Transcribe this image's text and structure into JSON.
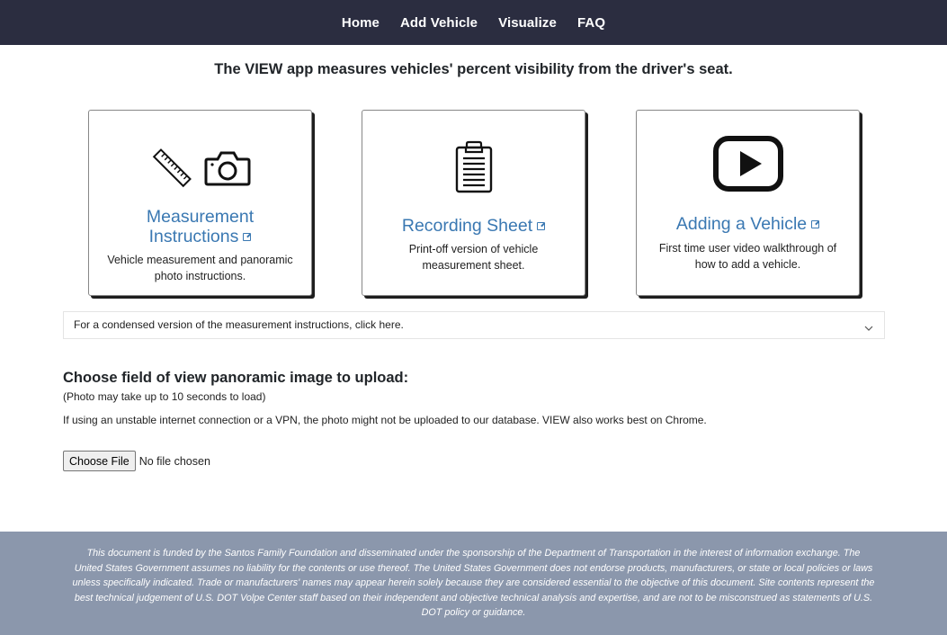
{
  "nav": {
    "items": [
      {
        "label": "Home"
      },
      {
        "label": "Add Vehicle"
      },
      {
        "label": "Visualize"
      },
      {
        "label": "FAQ"
      }
    ]
  },
  "headline": "The VIEW app measures vehicles' percent visibility from the driver's seat.",
  "cards": [
    {
      "title": "Measurement Instructions",
      "description": "Vehicle measurement and panoramic photo instructions.",
      "icons": [
        "ruler-icon",
        "camera-icon",
        "external-link-icon"
      ]
    },
    {
      "title": "Recording Sheet",
      "description": "Print-off version of vehicle measurement sheet.",
      "icons": [
        "clipboard-icon",
        "external-link-icon"
      ]
    },
    {
      "title": "Adding a Vehicle",
      "description": "First time user video walkthrough of how to add a vehicle.",
      "icons": [
        "video-play-icon",
        "external-link-icon"
      ]
    }
  ],
  "accordion": {
    "label": "For a condensed version of the measurement instructions, click here.",
    "icon": "chevron-down-icon"
  },
  "upload": {
    "title": "Choose field of view panoramic image to upload:",
    "subtitle": "(Photo may take up to 10 seconds to load)",
    "note": "If using an unstable internet connection or a VPN, the photo might not be uploaded to our database. VIEW also works best on Chrome.",
    "button_label": "Choose File",
    "status": "No file chosen"
  },
  "footer": {
    "text": "This document is funded by the Santos Family Foundation and disseminated under the sponsorship of the Department of Transportation in the interest of information exchange. The United States Government assumes no liability for the contents or use thereof. The United States Government does not endorse products, manufacturers, or state or local policies or laws unless specifically indicated. Trade or manufacturers' names may appear herein solely because they are considered essential to the objective of this document. Site contents represent the best technical judgement of U.S. DOT Volpe Center staff based on their independent and objective technical analysis and expertise, and are not to be misconstrued as statements of U.S. DOT policy or guidance."
  },
  "colors": {
    "navbar": "#2b2d40",
    "link": "#3a78b2",
    "footer": "#8b97ac"
  }
}
